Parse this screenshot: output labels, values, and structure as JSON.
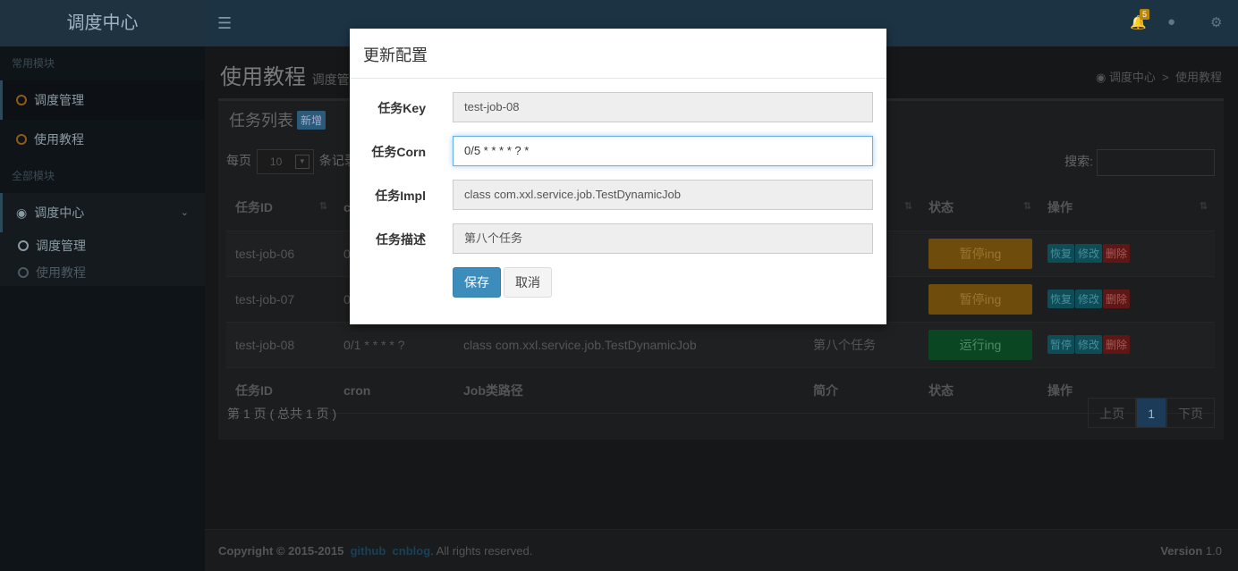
{
  "app": {
    "logo": "调度中心",
    "notification_count": "5"
  },
  "sidebar": {
    "header1": "常用模块",
    "header2": "全部模块",
    "items": [
      {
        "label": "调度管理"
      },
      {
        "label": "使用教程"
      },
      {
        "label": "调度中心"
      }
    ],
    "subitems": [
      {
        "label": "调度管理"
      },
      {
        "label": "使用教程"
      }
    ]
  },
  "page": {
    "title": "使用教程",
    "subtitle": "调度管",
    "breadcrumb_home": "调度中心",
    "breadcrumb_current": "使用教程"
  },
  "box": {
    "title": "任务列表",
    "add_label": "新增",
    "per_page_prefix": "每页",
    "per_page_value": "10",
    "per_page_suffix": "条记录",
    "search_label": "搜索:"
  },
  "table": {
    "headers": [
      "任务ID",
      "cron",
      "Job类路径",
      "简介",
      "状态",
      "操作"
    ],
    "header_cron_short": "c",
    "rows": [
      {
        "id": "test-job-06",
        "cron": "0",
        "status": "暂停ing"
      },
      {
        "id": "test-job-07",
        "cron": "0",
        "status": "暂停ing"
      },
      {
        "id": "test-job-08",
        "cron": "0/1 * * * * ?",
        "path": "class com.xxl.service.job.TestDynamicJob",
        "desc": "第八个任务",
        "status": "运行ing"
      }
    ],
    "actions_paused": [
      "恢复",
      "修改",
      "删除"
    ],
    "actions_running": [
      "暂停",
      "修改",
      "删除"
    ]
  },
  "pager": {
    "info": "第 1 页 ( 总共 1 页 )",
    "prev": "上页",
    "current": "1",
    "next": "下页"
  },
  "footer": {
    "copyright": "Copyright © 2015-2015",
    "link1": "github",
    "link2": "cnblog",
    "rights": ". All rights reserved.",
    "version_label": "Version",
    "version": "1.0"
  },
  "modal": {
    "title": "更新配置",
    "fields": [
      {
        "label": "任务Key",
        "value": "test-job-08"
      },
      {
        "label": "任务Corn",
        "value": "0/5 * * * * ? *"
      },
      {
        "label": "任务Impl",
        "value": "class com.xxl.service.job.TestDynamicJob"
      },
      {
        "label": "任务描述",
        "value": "第八个任务"
      }
    ],
    "save_label": "保存",
    "cancel_label": "取消"
  }
}
